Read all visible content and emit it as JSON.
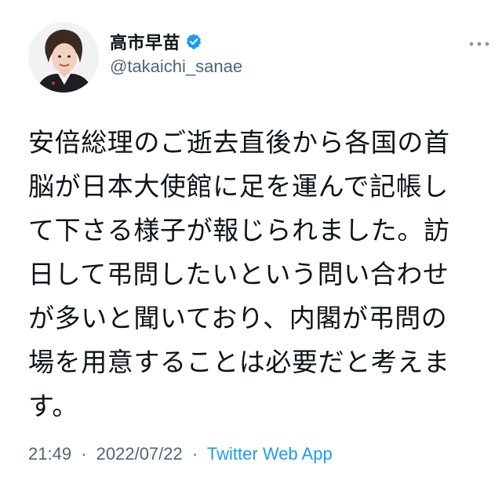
{
  "author": {
    "display_name": "高市早苗",
    "handle": "@takaichi_sanae",
    "verified": true
  },
  "tweet": {
    "lines": [
      "安倍総理のご逝去直後から各国の首",
      "脳が日本大使館に足を運んで記帳し",
      "て下さる様子が報じられました。訪",
      "日して弔問したいという問い合わせ",
      "が多いと聞いており、内閣が弔問の",
      "場を用意することは必要だと考えま",
      "す。"
    ]
  },
  "meta": {
    "time": "21:49",
    "date": "2022/07/22",
    "separator": "·",
    "source": "Twitter Web App"
  },
  "icons": {
    "verified": "verified-badge-icon",
    "more": "more-dots-icon"
  },
  "colors": {
    "text": "#0f1419",
    "secondary": "#536471",
    "accent": "#1d9bf0"
  }
}
